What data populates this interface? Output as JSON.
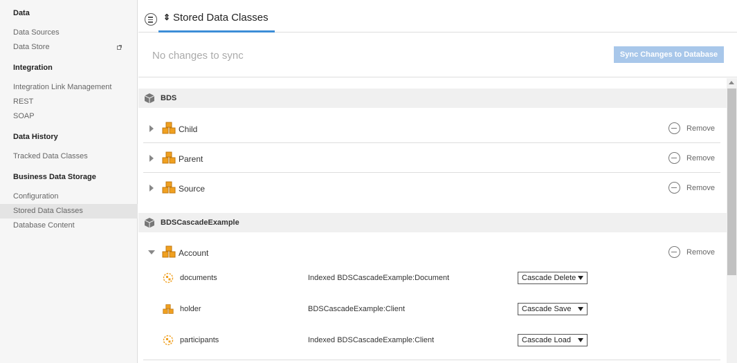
{
  "sidebar": {
    "sections": [
      {
        "heading": "Data",
        "items": [
          {
            "label": "Data Sources"
          },
          {
            "label": "Data Store",
            "icon": "external-link-icon"
          }
        ]
      },
      {
        "heading": "Integration",
        "items": [
          {
            "label": "Integration Link Management"
          },
          {
            "label": "REST"
          },
          {
            "label": "SOAP"
          }
        ]
      },
      {
        "heading": "Data History",
        "items": [
          {
            "label": "Tracked Data Classes"
          }
        ]
      },
      {
        "heading": "Business Data Storage",
        "items": [
          {
            "label": "Configuration"
          },
          {
            "label": "Stored Data Classes",
            "active": true
          },
          {
            "label": "Database Content"
          }
        ]
      }
    ]
  },
  "header": {
    "tab_label": "Stored Data Classes",
    "tab_icon": "sync-icon",
    "accent_color": "#3c8dd7"
  },
  "sync": {
    "status": "No changes to sync",
    "button_label": "Sync Changes to Database",
    "button_color": "#a8c7ea"
  },
  "groups": [
    {
      "name": "BDS",
      "classes": [
        {
          "name": "Child",
          "remove_label": "Remove"
        },
        {
          "name": "Parent",
          "remove_label": "Remove"
        },
        {
          "name": "Source",
          "remove_label": "Remove"
        }
      ]
    },
    {
      "name": "BDSCascadeExample",
      "classes": [
        {
          "name": "Account",
          "remove_label": "Remove",
          "expanded": true,
          "properties": [
            {
              "name": "documents",
              "type": "Indexed BDSCascadeExample:Document",
              "cascade": "Cascade Delete",
              "icon": "indexed-icon"
            },
            {
              "name": "holder",
              "type": "BDSCascadeExample:Client",
              "cascade": "Cascade Save",
              "icon": "class-icon"
            },
            {
              "name": "participants",
              "type": "Indexed BDSCascadeExample:Client",
              "cascade": "Cascade Load",
              "icon": "indexed-icon"
            }
          ]
        }
      ]
    }
  ],
  "colors": {
    "class_icon": "#f0a020",
    "group_icon": "#777777"
  }
}
